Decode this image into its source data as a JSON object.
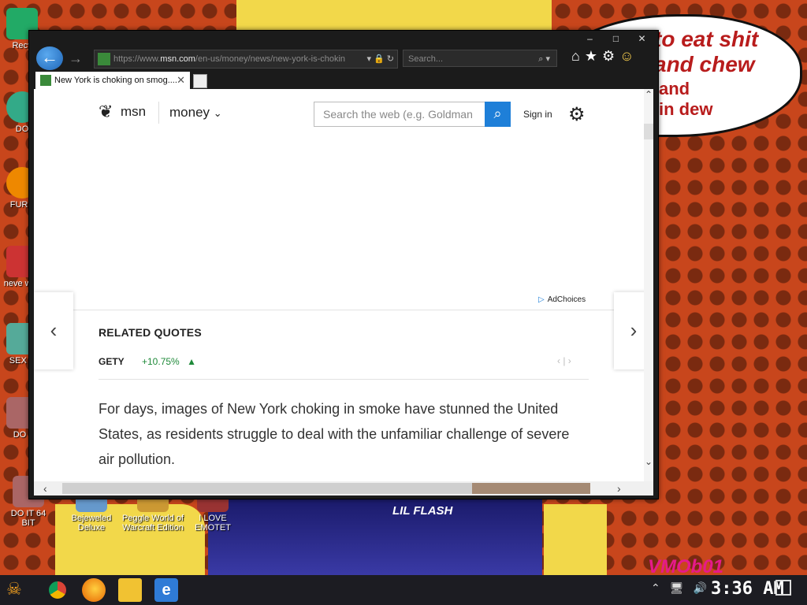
{
  "desktop": {
    "icons": [
      {
        "label": "Recy",
        "color": "#2a6"
      },
      {
        "label": "DO",
        "color": "#3a8"
      },
      {
        "label": "FURR",
        "color": "#e80"
      },
      {
        "label": "neve why",
        "color": "#c33"
      },
      {
        "label": "SEX E",
        "color": "#5a9"
      },
      {
        "label": "DO I",
        "color": "#a66"
      },
      {
        "label": "DO IT 64 BIT",
        "color": "#a66"
      },
      {
        "label": "Bejeweled Deluxe",
        "color": "#69c"
      },
      {
        "label": "Peggle World of Warcraft Edition",
        "color": "#c93"
      },
      {
        "label": "I LOVE EMOTET",
        "color": "#933"
      }
    ],
    "bubble": {
      "line1": "to eat shit",
      "line2": "and chew",
      "line3": "and",
      "line4": "in dew"
    },
    "poster_title": "LIL FLASH",
    "watermark": "VMOb01"
  },
  "window": {
    "controls": {
      "minimize": "–",
      "maximize": "□",
      "close": "✕"
    },
    "back_icon": "←",
    "forward_icon": "→",
    "address": {
      "scheme": "https://www.",
      "host": "msn.com",
      "path": "/en-us/money/news/new-york-is-chokin",
      "tools": "▾ 🔒 ↻"
    },
    "search": {
      "placeholder": "Search...",
      "icon": "⌕ ▾"
    },
    "cmd_icons": [
      "home-icon",
      "star-icon",
      "gear-icon",
      "smiley-icon"
    ],
    "tab": {
      "title": "New York is choking on smog....",
      "close": "✕"
    }
  },
  "page": {
    "logo_text": "msn",
    "section": "money",
    "section_chevron": "⌄",
    "search_placeholder": "Search the web (e.g. Goldman",
    "search_icon": "⌕",
    "signin": "Sign in",
    "adchoices": "AdChoices",
    "related_title": "RELATED QUOTES",
    "quote": {
      "ticker": "GETY",
      "change": "+10.75%",
      "arrow": "▲"
    },
    "quote_nav": "‹  |  ›",
    "article": "For days, images of New York choking in smoke have stunned the United States, as residents struggle to deal with the unfamiliar challenge of severe air pollution.",
    "prev_arrow": "‹",
    "next_arrow": "›"
  },
  "scrollbars": {
    "up": "⌃",
    "down": "⌄",
    "left": "‹",
    "right": "›"
  },
  "taskbar": {
    "start_label": "☠",
    "clock": "3:36 AM",
    "tray": [
      "⌃",
      "🖥",
      "🔊"
    ],
    "apps": [
      "chrome-icon",
      "firefox-icon",
      "file-explorer-icon",
      "internet-explorer-icon"
    ]
  },
  "colors": {
    "accent": "#1e7fd8",
    "positive": "#1f8a3a",
    "window_chrome": "#1b1b1b"
  }
}
